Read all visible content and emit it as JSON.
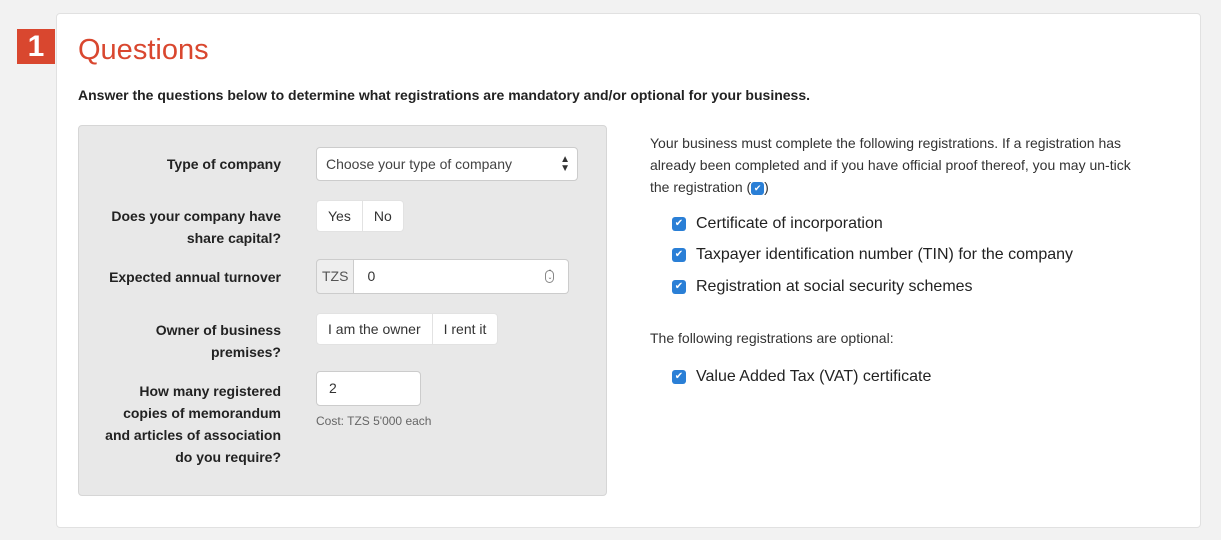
{
  "step": {
    "number": "1"
  },
  "header": {
    "title": "Questions",
    "intro": "Answer the questions below to determine what registrations are mandatory and/or optional for your business."
  },
  "form": {
    "company_type": {
      "label": "Type of company",
      "value": "Choose your type of company"
    },
    "share_capital": {
      "label_line1": "Does your company have",
      "label_line2": "share capital?",
      "options": [
        "Yes",
        "No"
      ]
    },
    "turnover": {
      "label": "Expected annual turnover",
      "currency": "TZS",
      "value": "0"
    },
    "premises": {
      "label_line1": "Owner of business",
      "label_line2": "premises?",
      "options": [
        "I am the owner",
        "I rent it"
      ]
    },
    "copies": {
      "label_lines": [
        "How many registered",
        "copies of memorandum",
        "and articles of association",
        "do you require?"
      ],
      "value": "2",
      "cost_hint": "Cost: TZS 5'000 each"
    }
  },
  "registrations": {
    "mandatory_intro_1": "Your business must complete the following registrations. If a registration has",
    "mandatory_intro_2": "already been completed and if you have official proof thereof, you may un-tick",
    "mandatory_intro_3a": "the registration (",
    "mandatory_intro_3b": ")",
    "mandatory": [
      "Certificate of incorporation",
      "Taxpayer identification number (TIN) for the company",
      "Registration at social security schemes"
    ],
    "optional_intro": "The following registrations are optional:",
    "optional": [
      "Value Added Tax (VAT) certificate"
    ]
  },
  "colors": {
    "accent_red": "#d9472f",
    "checkbox_blue": "#2a7fd6"
  }
}
